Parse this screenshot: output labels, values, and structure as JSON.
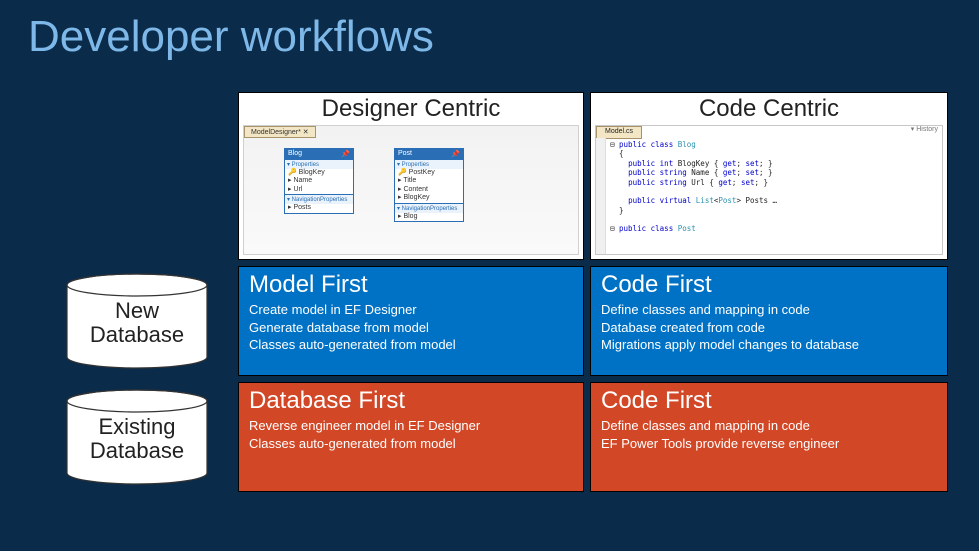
{
  "title": "Developer workflows",
  "columns": {
    "designer": {
      "title": "Designer Centric",
      "tab": "ModelDesigner* ✕",
      "entity1": {
        "name": "Blog",
        "props_label": "▾ Properties",
        "p1": "🔑 BlogKey",
        "p2": "▸ Name",
        "p3": "▸ Url",
        "nav_label": "▾ NavigationProperties",
        "n1": "▸ Posts"
      },
      "entity2": {
        "name": "Post",
        "props_label": "▾ Properties",
        "p1": "🔑 PostKey",
        "p2": "▸ Title",
        "p3": "▸ Content",
        "p4": "▸ BlogKey",
        "nav_label": "▾ NavigationProperties",
        "n1": "▸ Blog"
      }
    },
    "code": {
      "title": "Code Centric",
      "tab": "Model.cs",
      "hist": "▾ History"
    }
  },
  "rows": {
    "new_db": {
      "label_l1": "New",
      "label_l2": "Database"
    },
    "existing_db": {
      "label_l1": "Existing",
      "label_l2": "Database"
    }
  },
  "cells": {
    "model_first": {
      "heading": "Model First",
      "l1": "Create model in EF Designer",
      "l2": "Generate database from model",
      "l3": "Classes auto-generated from model"
    },
    "code_first_new": {
      "heading": "Code First",
      "l1": "Define classes and mapping in code",
      "l2": "Database created from code",
      "l3": "Migrations apply model changes to database"
    },
    "db_first": {
      "heading": "Database First",
      "l1": "Reverse engineer model in EF Designer",
      "l2": "Classes auto-generated from model"
    },
    "code_first_existing": {
      "heading": "Code First",
      "l1": "Define classes and mapping in code",
      "l2": "EF Power Tools provide reverse engineer"
    }
  }
}
